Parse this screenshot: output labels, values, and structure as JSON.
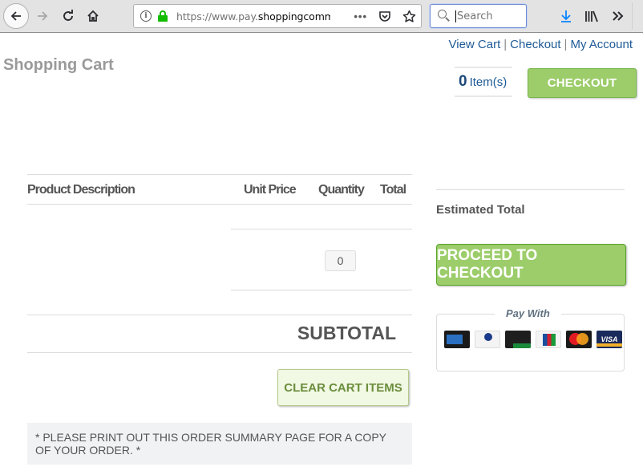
{
  "browser": {
    "url_prefix": "https://www.pay.",
    "url_host": "shoppingcommerce",
    "search_placeholder": "Search",
    "more_label": "•••",
    "overflow_label": "»"
  },
  "header": {
    "links": [
      "View Cart",
      "Checkout",
      "My Account"
    ],
    "separator": "|",
    "title": "Shopping Cart",
    "item_count": "0",
    "item_count_label": "Item(s)",
    "checkout_label": "CHECKOUT"
  },
  "cart": {
    "columns": [
      "Product Description",
      "Unit Price",
      "Quantity",
      "Total"
    ],
    "quantity_value": "0",
    "subtotal_label": "SUBTOTAL",
    "clear_label": "CLEAR CART ITEMS",
    "notice": "* PLEASE PRINT OUT THIS ORDER SUMMARY PAGE FOR A COPY OF YOUR ORDER. *"
  },
  "summary": {
    "estimated_total_label": "Estimated Total",
    "proceed_label": "PROCEED TO CHECKOUT",
    "pay_with_label": "Pay With",
    "cards": [
      "American Express",
      "Diners Club International",
      "Discover Novus",
      "JCB",
      "MasterCard",
      "VISA"
    ],
    "visa_text": "VISA"
  },
  "colors": {
    "accent_green": "#9ccd6a",
    "link_blue": "#1e5a96",
    "heading_gray": "#9a9a9a"
  }
}
